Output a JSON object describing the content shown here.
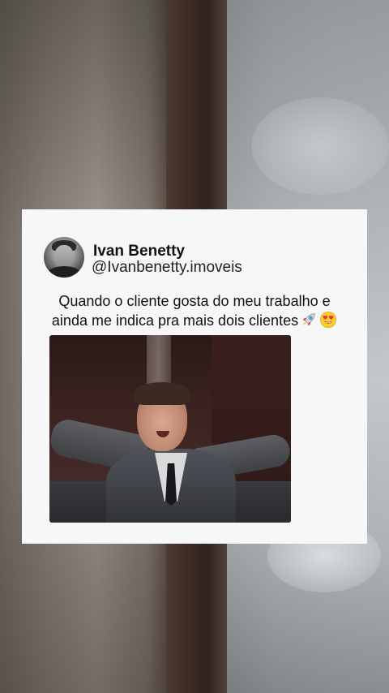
{
  "post": {
    "author_name": "Ivan Benetty",
    "author_handle": "@Ivanbenetty.imoveis",
    "caption_line1": "Quando o cliente gosta do meu trabalho e",
    "caption_line2": "ainda me indica pra mais dois clientes",
    "caption_emojis": [
      "rocket-emoji",
      "heart-eyes-emoji"
    ]
  },
  "media": {
    "kind": "video-frame",
    "subject": "man-in-suit-arms-spread"
  },
  "colors": {
    "card_background": "#f7f7f8",
    "text": "#111111"
  }
}
